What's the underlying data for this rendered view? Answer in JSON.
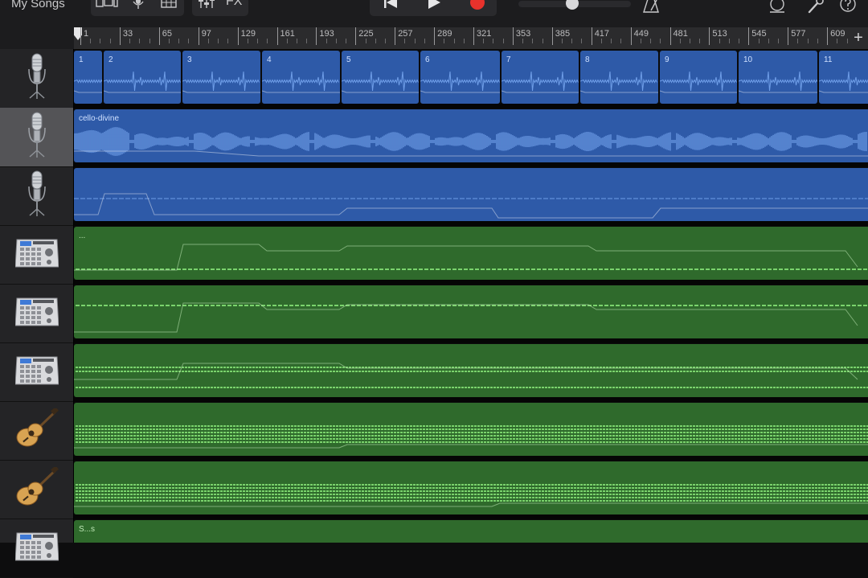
{
  "toolbar": {
    "my_songs": "My Songs",
    "fx": "FX"
  },
  "ruler": {
    "labels": [
      "1",
      "33",
      "65",
      "97",
      "129",
      "161",
      "193",
      "225",
      "257",
      "289",
      "321",
      "353",
      "385",
      "417",
      "449",
      "481",
      "513",
      "545",
      "577",
      "609"
    ],
    "add": "+"
  },
  "tracks": [
    {
      "icon": "microphone-icon",
      "type": "audio"
    },
    {
      "icon": "microphone-icon",
      "type": "audio",
      "selected": true
    },
    {
      "icon": "microphone-icon",
      "type": "audio"
    },
    {
      "icon": "drum-machine-icon",
      "type": "midi"
    },
    {
      "icon": "drum-machine-icon",
      "type": "midi"
    },
    {
      "icon": "drum-machine-icon",
      "type": "midi"
    },
    {
      "icon": "acoustic-guitar-icon",
      "type": "midi"
    },
    {
      "icon": "acoustic-guitar-icon",
      "type": "midi"
    },
    {
      "icon": "drum-machine-icon",
      "type": "midi"
    }
  ],
  "regions": {
    "track1_labels": [
      "1",
      "2",
      "3",
      "4",
      "5",
      "6",
      "7",
      "8",
      "9",
      "10",
      "11"
    ],
    "track2_label": "cello-divine",
    "track4_label": "...",
    "track9_label": "S...s"
  },
  "colors": {
    "audio_region": "#2e5aa8",
    "audio_wave": "#6f9ee8",
    "midi_region": "#2f6a2c",
    "midi_notes": "#7ad36c",
    "record": "#e8322c"
  }
}
